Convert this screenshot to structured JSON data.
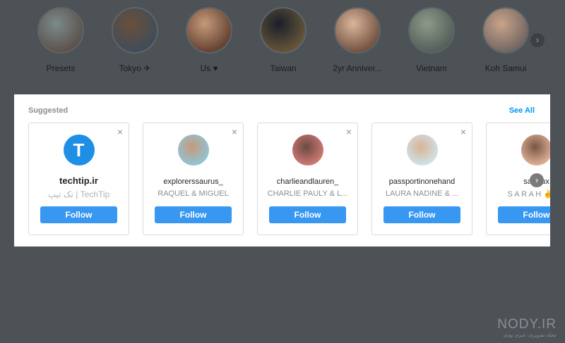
{
  "highlights": [
    {
      "label": "Presets",
      "colors": [
        "#7b8a8c",
        "#5a4d45"
      ]
    },
    {
      "label": "Tokyo ✈",
      "colors": [
        "#6b4f3a",
        "#3b4d5c"
      ]
    },
    {
      "label": "Us ♥",
      "colors": [
        "#c49a7a",
        "#5c3b2b"
      ]
    },
    {
      "label": "Taiwan",
      "colors": [
        "#1a1f2b",
        "#6b5a3a"
      ]
    },
    {
      "label": "2yr Anniver...",
      "colors": [
        "#d9b59a",
        "#6a4a3a"
      ]
    },
    {
      "label": "Vietnam",
      "colors": [
        "#8d9a8a",
        "#4f5a55"
      ]
    },
    {
      "label": "Koh Samui",
      "colors": [
        "#c9a489",
        "#6b6160"
      ]
    }
  ],
  "highlights_next_icon": "›",
  "suggested": {
    "title": "Suggested",
    "see_all": "See All",
    "close_glyph": "×",
    "next_icon": "›",
    "cards": [
      {
        "username": "techtip.ir",
        "fullname": "تک تیپ | TechTip",
        "follow": "Follow",
        "avatar": "logo-T",
        "logo_glyph": "T",
        "colors": [
          "#1f8fe6",
          "#1f8fe6"
        ]
      },
      {
        "username": "explorerssaurus_",
        "fullname": "RAQUEL & MIGUEL",
        "follow": "Follow",
        "avatar": "couple-beach",
        "colors": [
          "#8fc6d8",
          "#c59a7c"
        ]
      },
      {
        "username": "charlieandlauren_",
        "fullname": "CHARLIE PAULY & L...",
        "follow": "Follow",
        "avatar": "couple",
        "colors": [
          "#d27b78",
          "#6b4a40"
        ]
      },
      {
        "username": "passportinonehand",
        "fullname": "LAURA NADINE & ...",
        "follow": "Follow",
        "avatar": "beach-woman",
        "colors": [
          "#cfe3ec",
          "#d8b494"
        ]
      },
      {
        "username": "saltylux",
        "fullname": "S A R A H ✌️ TR",
        "follow": "Follow",
        "avatar": "woman",
        "colors": [
          "#e0b49a",
          "#7a5544"
        ]
      }
    ]
  },
  "watermark": {
    "brand": "NODY.IR",
    "tagline": "مجله تصویری، خبری نودی"
  }
}
